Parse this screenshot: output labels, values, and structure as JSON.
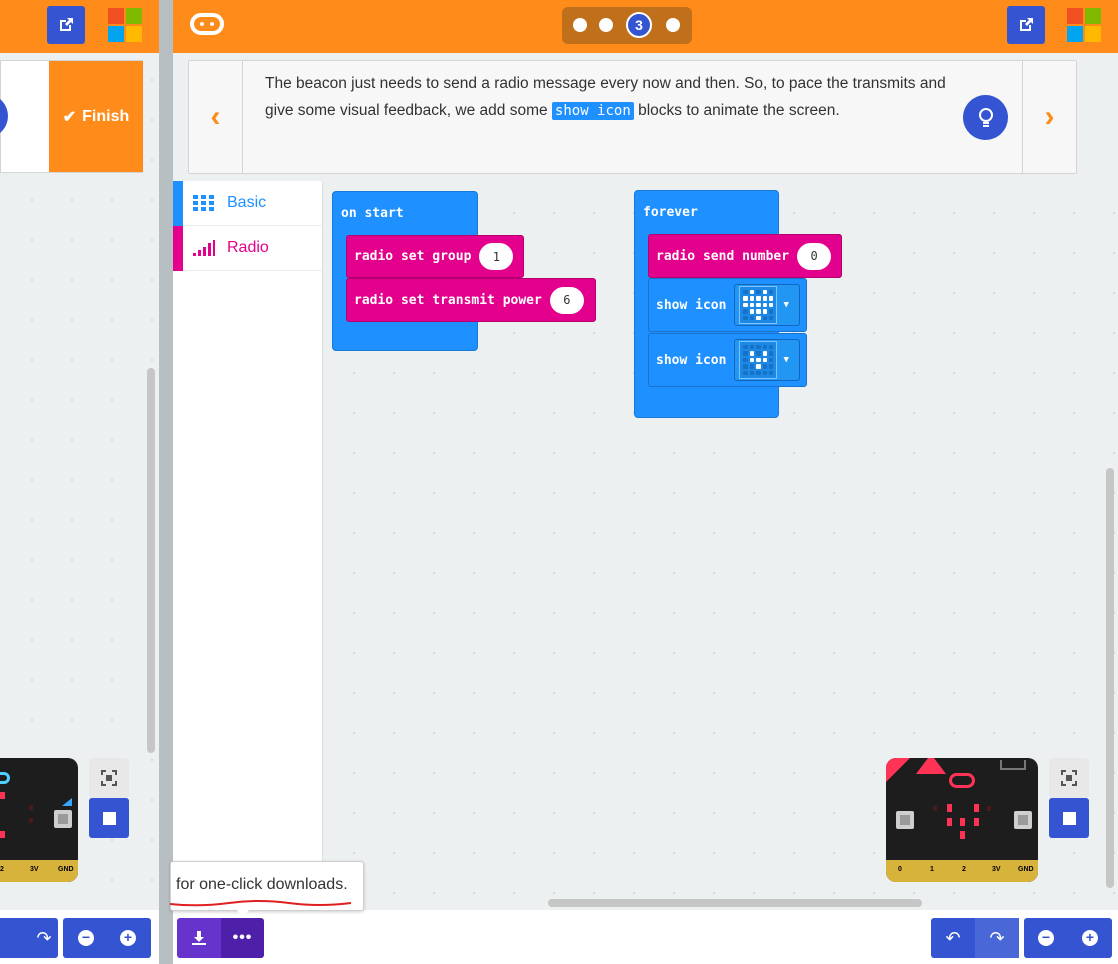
{
  "tutorial": {
    "step_dots": [
      "",
      "",
      "3",
      ""
    ],
    "text_before": "The beacon just needs to send a radio message every now and then. So, to pace the transmits and give some visual feedback, we add some ",
    "code_chip": "show icon",
    "text_after": " blocks to animate the screen.",
    "finish_label": "Finish"
  },
  "toolbox": {
    "categories": [
      {
        "label": "Basic",
        "color": "#1e90ff"
      },
      {
        "label": "Radio",
        "color": "#e3008c"
      }
    ]
  },
  "blocks": {
    "on_start": {
      "header": "on start",
      "set_group_label": "radio set group",
      "set_group_value": "1",
      "set_power_label": "radio set transmit power",
      "set_power_value": "6"
    },
    "forever": {
      "header": "forever",
      "send_number_label": "radio send number",
      "send_number_value": "0",
      "show_icon_1_label": "show icon",
      "show_icon_2_label": "show icon"
    }
  },
  "left_sim": {
    "pins": [
      "2",
      "3V",
      "GND"
    ]
  },
  "right_sim": {
    "pins": [
      "0",
      "1",
      "2",
      "3V",
      "GND"
    ]
  },
  "tooltip": {
    "text": "for one-click downloads."
  },
  "colors": {
    "topbar": "#ff8c1a",
    "accent_blue": "#3454d1",
    "basic_block": "#1e90ff",
    "radio_block": "#e3008c",
    "download": "#6633cc"
  },
  "icons": [
    "external-link-icon",
    "microsoft-logo-icon",
    "microbit-logo-icon",
    "lightbulb-icon",
    "chevron-left-icon",
    "chevron-right-icon",
    "grid-icon",
    "signal-bars-icon",
    "download-icon",
    "more-icon",
    "undo-icon",
    "redo-icon",
    "zoom-in-icon",
    "zoom-out-icon",
    "fullscreen-icon",
    "stop-icon"
  ]
}
